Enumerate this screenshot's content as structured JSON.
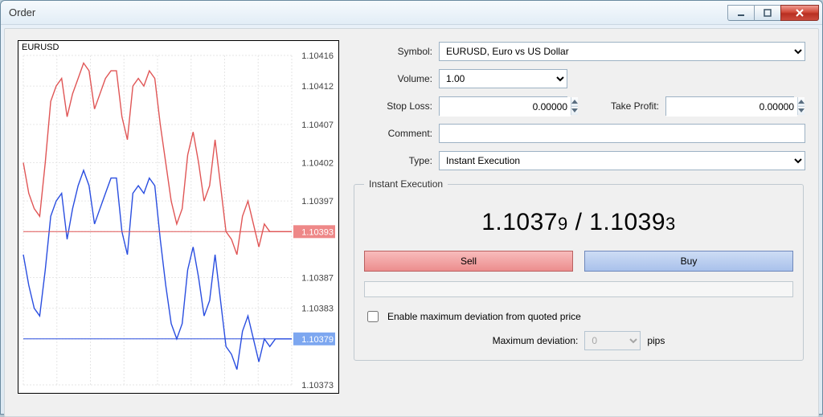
{
  "window": {
    "title": "Order"
  },
  "chart": {
    "label": "EURUSD",
    "price_axis": [
      "1.10416",
      "1.10412",
      "1.10407",
      "1.10402",
      "1.10397",
      "1.10393",
      "1.10387",
      "1.10383",
      "1.10379",
      "1.10373"
    ],
    "ask_tag": "1.10393",
    "bid_tag": "1.10379"
  },
  "form": {
    "symbol_label": "Symbol:",
    "symbol_value": "EURUSD, Euro vs US Dollar",
    "volume_label": "Volume:",
    "volume_value": "1.00",
    "stoploss_label": "Stop Loss:",
    "stoploss_value": "0.00000",
    "takeprofit_label": "Take Profit:",
    "takeprofit_value": "0.00000",
    "comment_label": "Comment:",
    "comment_value": "",
    "type_label": "Type:",
    "type_value": "Instant Execution"
  },
  "exec": {
    "legend": "Instant Execution",
    "bid_big": "1.1037",
    "bid_small": "9",
    "sep": " / ",
    "ask_big": "1.1039",
    "ask_small": "3",
    "sell_label": "Sell",
    "buy_label": "Buy"
  },
  "dev": {
    "enable_label": "Enable maximum deviation from quoted price",
    "max_label": "Maximum deviation:",
    "max_value": "0",
    "pips_label": "pips"
  },
  "chart_data": {
    "type": "line",
    "xlabel": "",
    "ylabel": "",
    "ylim": [
      1.10373,
      1.10416
    ],
    "x": [
      0,
      1,
      2,
      3,
      4,
      5,
      6,
      7,
      8,
      9,
      10,
      11,
      12,
      13,
      14,
      15,
      16,
      17,
      18,
      19,
      20,
      21,
      22,
      23,
      24,
      25,
      26,
      27,
      28,
      29,
      30,
      31,
      32,
      33,
      34,
      35,
      36,
      37,
      38,
      39,
      40,
      41,
      42,
      43,
      44,
      45,
      46,
      47,
      48,
      49
    ],
    "series": [
      {
        "name": "ask",
        "color": "#e05656",
        "values": [
          1.10402,
          1.10398,
          1.10396,
          1.10395,
          1.10402,
          1.1041,
          1.10412,
          1.10413,
          1.10408,
          1.10411,
          1.10413,
          1.10415,
          1.10414,
          1.10409,
          1.10411,
          1.10413,
          1.10414,
          1.10414,
          1.10408,
          1.10405,
          1.10412,
          1.10413,
          1.10412,
          1.10414,
          1.10413,
          1.10407,
          1.10402,
          1.10397,
          1.10394,
          1.10396,
          1.10403,
          1.10406,
          1.10402,
          1.10397,
          1.10399,
          1.10405,
          1.10399,
          1.10393,
          1.10392,
          1.1039,
          1.10395,
          1.10397,
          1.10394,
          1.10391,
          1.10394,
          1.10393,
          1.10393,
          1.10393,
          1.10393,
          1.10393
        ]
      },
      {
        "name": "bid",
        "color": "#2a4ee0",
        "values": [
          1.1039,
          1.10386,
          1.10383,
          1.10382,
          1.10388,
          1.10395,
          1.10397,
          1.10398,
          1.10392,
          1.10396,
          1.10399,
          1.10401,
          1.10399,
          1.10394,
          1.10396,
          1.10398,
          1.104,
          1.104,
          1.10393,
          1.1039,
          1.10398,
          1.10399,
          1.10398,
          1.104,
          1.10399,
          1.10392,
          1.10386,
          1.10381,
          1.10379,
          1.10381,
          1.10388,
          1.10391,
          1.10387,
          1.10382,
          1.10384,
          1.1039,
          1.10384,
          1.10378,
          1.10377,
          1.10375,
          1.1038,
          1.10382,
          1.10379,
          1.10376,
          1.10379,
          1.10378,
          1.10379,
          1.10379,
          1.10379,
          1.10379
        ]
      }
    ],
    "ask_current": 1.10393,
    "bid_current": 1.10379
  }
}
